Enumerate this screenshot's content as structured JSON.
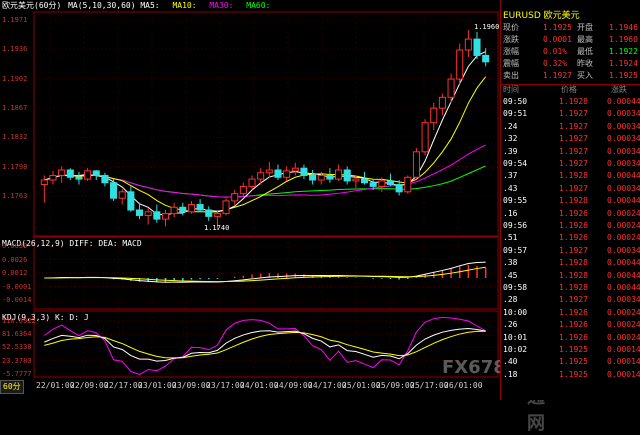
{
  "header": {
    "title": "欧元美元(60分)",
    "ma_label": "MA(5,10,30,60) MA5:",
    "ma10": "MA10:",
    "ma30": "MA30:",
    "ma60": "MA60:",
    "macd_label": "MACD(26,12,9) DIFF: DEA: MACD",
    "kdj_label": "KDJ(9,3,3) K: D: J",
    "period_tab": "60分"
  },
  "price_axis": [
    "1.1971",
    "1.1936",
    "1.1902",
    "1.1867",
    "1.1832",
    "1.1798",
    "1.1763"
  ],
  "macd_axis": [
    "0.0039",
    "0.0026",
    "0.0012",
    "-0.0001",
    "-0.0014"
  ],
  "kdj_axis": [
    "110.5922",
    "81.6364",
    "52.5338",
    "23.3780",
    "-5.7777"
  ],
  "time_axis": [
    "22/01:00",
    "22/09:00",
    "22/17:00",
    "23/01:00",
    "23/09:00",
    "23/17:00",
    "24/01:00",
    "24/09:00",
    "24/17:00",
    "25/01:00",
    "25/09:00",
    "25/17:00",
    "26/01:00"
  ],
  "annotations": {
    "high": "1.1960",
    "low": "1.1740"
  },
  "colors": {
    "up": "#ff3030",
    "down": "#30e0e0",
    "ma5": "#ffffff",
    "ma10": "#ffff00",
    "ma30": "#ff00ff",
    "ma60": "#00ff00",
    "axis": "#8b0000",
    "grid": "#3a0000"
  },
  "chart_data": {
    "type": "candlestick",
    "series": [
      {
        "name": "EURUSD",
        "values": [
          [
            1.179,
            1.18,
            1.177,
            1.1795
          ],
          [
            1.1795,
            1.1805,
            1.179,
            1.18
          ],
          [
            1.18,
            1.181,
            1.1792,
            1.1806
          ],
          [
            1.1806,
            1.1808,
            1.1795,
            1.1798
          ],
          [
            1.1798,
            1.1804,
            1.179,
            1.1796
          ],
          [
            1.1796,
            1.1808,
            1.1794,
            1.1805
          ],
          [
            1.1805,
            1.1806,
            1.1795,
            1.18
          ],
          [
            1.18,
            1.1803,
            1.1788,
            1.1792
          ],
          [
            1.1792,
            1.1796,
            1.1772,
            1.1775
          ],
          [
            1.1775,
            1.1785,
            1.1768,
            1.1782
          ],
          [
            1.1782,
            1.1788,
            1.176,
            1.1762
          ],
          [
            1.1762,
            1.177,
            1.1752,
            1.1756
          ],
          [
            1.1756,
            1.1764,
            1.1746,
            1.176
          ],
          [
            1.176,
            1.1768,
            1.1748,
            1.1752
          ],
          [
            1.1752,
            1.1762,
            1.1744,
            1.1758
          ],
          [
            1.1758,
            1.177,
            1.1754,
            1.1765
          ],
          [
            1.1765,
            1.177,
            1.1756,
            1.176
          ],
          [
            1.176,
            1.1772,
            1.1758,
            1.1768
          ],
          [
            1.1768,
            1.1774,
            1.176,
            1.1762
          ],
          [
            1.1762,
            1.1766,
            1.175,
            1.1755
          ],
          [
            1.1755,
            1.1762,
            1.174,
            1.1758
          ],
          [
            1.1758,
            1.1775,
            1.1756,
            1.1772
          ],
          [
            1.1772,
            1.1784,
            1.1768,
            1.178
          ],
          [
            1.178,
            1.1792,
            1.1776,
            1.1788
          ],
          [
            1.1788,
            1.18,
            1.1784,
            1.1796
          ],
          [
            1.1796,
            1.1808,
            1.179,
            1.1803
          ],
          [
            1.1803,
            1.1815,
            1.1798,
            1.1806
          ],
          [
            1.1806,
            1.1812,
            1.1795,
            1.1798
          ],
          [
            1.1798,
            1.181,
            1.1794,
            1.1805
          ],
          [
            1.1805,
            1.1814,
            1.18,
            1.1808
          ],
          [
            1.1808,
            1.1812,
            1.1796,
            1.18
          ],
          [
            1.18,
            1.1806,
            1.179,
            1.1795
          ],
          [
            1.1795,
            1.1804,
            1.179,
            1.18
          ],
          [
            1.18,
            1.1808,
            1.1792,
            1.1796
          ],
          [
            1.1796,
            1.1812,
            1.1794,
            1.1806
          ],
          [
            1.1806,
            1.181,
            1.179,
            1.1794
          ],
          [
            1.1794,
            1.18,
            1.1786,
            1.1796
          ],
          [
            1.1796,
            1.1804,
            1.179,
            1.1792
          ],
          [
            1.1792,
            1.1796,
            1.1784,
            1.1788
          ],
          [
            1.1788,
            1.1798,
            1.1782,
            1.1794
          ],
          [
            1.1794,
            1.1802,
            1.1788,
            1.179
          ],
          [
            1.179,
            1.1795,
            1.1778,
            1.1782
          ],
          [
            1.1782,
            1.18,
            1.178,
            1.1798
          ],
          [
            1.1798,
            1.183,
            1.1796,
            1.1826
          ],
          [
            1.1826,
            1.1862,
            1.1822,
            1.1858
          ],
          [
            1.1858,
            1.188,
            1.185,
            1.1874
          ],
          [
            1.1874,
            1.189,
            1.1866,
            1.1886
          ],
          [
            1.1886,
            1.1912,
            1.188,
            1.1906
          ],
          [
            1.1906,
            1.1945,
            1.19,
            1.1938
          ],
          [
            1.1938,
            1.196,
            1.193,
            1.195
          ],
          [
            1.195,
            1.1958,
            1.1928,
            1.1932
          ],
          [
            1.1932,
            1.194,
            1.192,
            1.1925
          ]
        ]
      }
    ],
    "ylim": [
      1.174,
      1.1971
    ],
    "x_ticks": [
      "22/01:00",
      "22/09:00",
      "22/17:00",
      "23/01:00",
      "23/09:00",
      "23/17:00",
      "24/01:00",
      "24/09:00",
      "24/17:00",
      "25/01:00",
      "25/09:00",
      "25/17:00",
      "26/01:00"
    ]
  },
  "quote": {
    "symbol": "EURUSD 欧元美元",
    "rows": [
      {
        "l1": "现价",
        "v1": "1.1925",
        "l2": "开盘",
        "v2": "1.1946"
      },
      {
        "l1": "涨跌",
        "v1": "0.0001",
        "l2": "最高",
        "v2": "1.1960"
      },
      {
        "l1": "涨幅",
        "v1": "0.01%",
        "l2": "最低",
        "v2": "1.1922"
      },
      {
        "l1": "震幅",
        "v1": "0.32%",
        "l2": "昨收",
        "v2": "1.1924"
      },
      {
        "l1": "卖出",
        "v1": "1.1927",
        "l2": "买入",
        "v2": "1.1925"
      }
    ],
    "table_header": {
      "c1": "时间",
      "c2": "价格",
      "c3": "涨跌"
    },
    "ticks": [
      {
        "t": "09:50",
        "p": "1.1928",
        "c": "0.00044"
      },
      {
        "t": "09:51",
        "p": "1.1927",
        "c": "0.00034"
      },
      {
        "t": ".24",
        "p": "1.1927",
        "c": "0.00034"
      },
      {
        "t": ".32",
        "p": "1.1927",
        "c": "0.00034"
      },
      {
        "t": ".39",
        "p": "1.1927",
        "c": "0.00034"
      },
      {
        "t": "09:54",
        "p": "1.1927",
        "c": "0.00034"
      },
      {
        "t": ".37",
        "p": "1.1928",
        "c": "0.00044"
      },
      {
        "t": ".43",
        "p": "1.1927",
        "c": "0.00034"
      },
      {
        "t": "09:55",
        "p": "1.1928",
        "c": "0.00044"
      },
      {
        "t": ".16",
        "p": "1.1926",
        "c": "0.00024"
      },
      {
        "t": "09:56",
        "p": "1.1926",
        "c": "0.00024"
      },
      {
        "t": ".51",
        "p": "1.1926",
        "c": "0.00024"
      },
      {
        "t": "09:57",
        "p": "1.1927",
        "c": "0.00034"
      },
      {
        "t": ".38",
        "p": "1.1928",
        "c": "0.00044"
      },
      {
        "t": ".45",
        "p": "1.1928",
        "c": "0.00044"
      },
      {
        "t": "09:58",
        "p": "1.1928",
        "c": "0.00044"
      },
      {
        "t": ".28",
        "p": "1.1927",
        "c": "0.00034"
      },
      {
        "t": "10:00",
        "p": "1.1926",
        "c": "0.00024"
      },
      {
        "t": ".26",
        "p": "1.1926",
        "c": "0.00024"
      },
      {
        "t": "10:01",
        "p": "1.1926",
        "c": "0.00024"
      },
      {
        "t": "10:02",
        "p": "1.1925",
        "c": "0.00014"
      },
      {
        "t": ".40",
        "p": "1.1925",
        "c": "0.00014"
      },
      {
        "t": ".18",
        "p": "1.1925",
        "c": "0.00014"
      }
    ]
  },
  "watermark": {
    "text": "FX678",
    "text2": "汇通网"
  }
}
